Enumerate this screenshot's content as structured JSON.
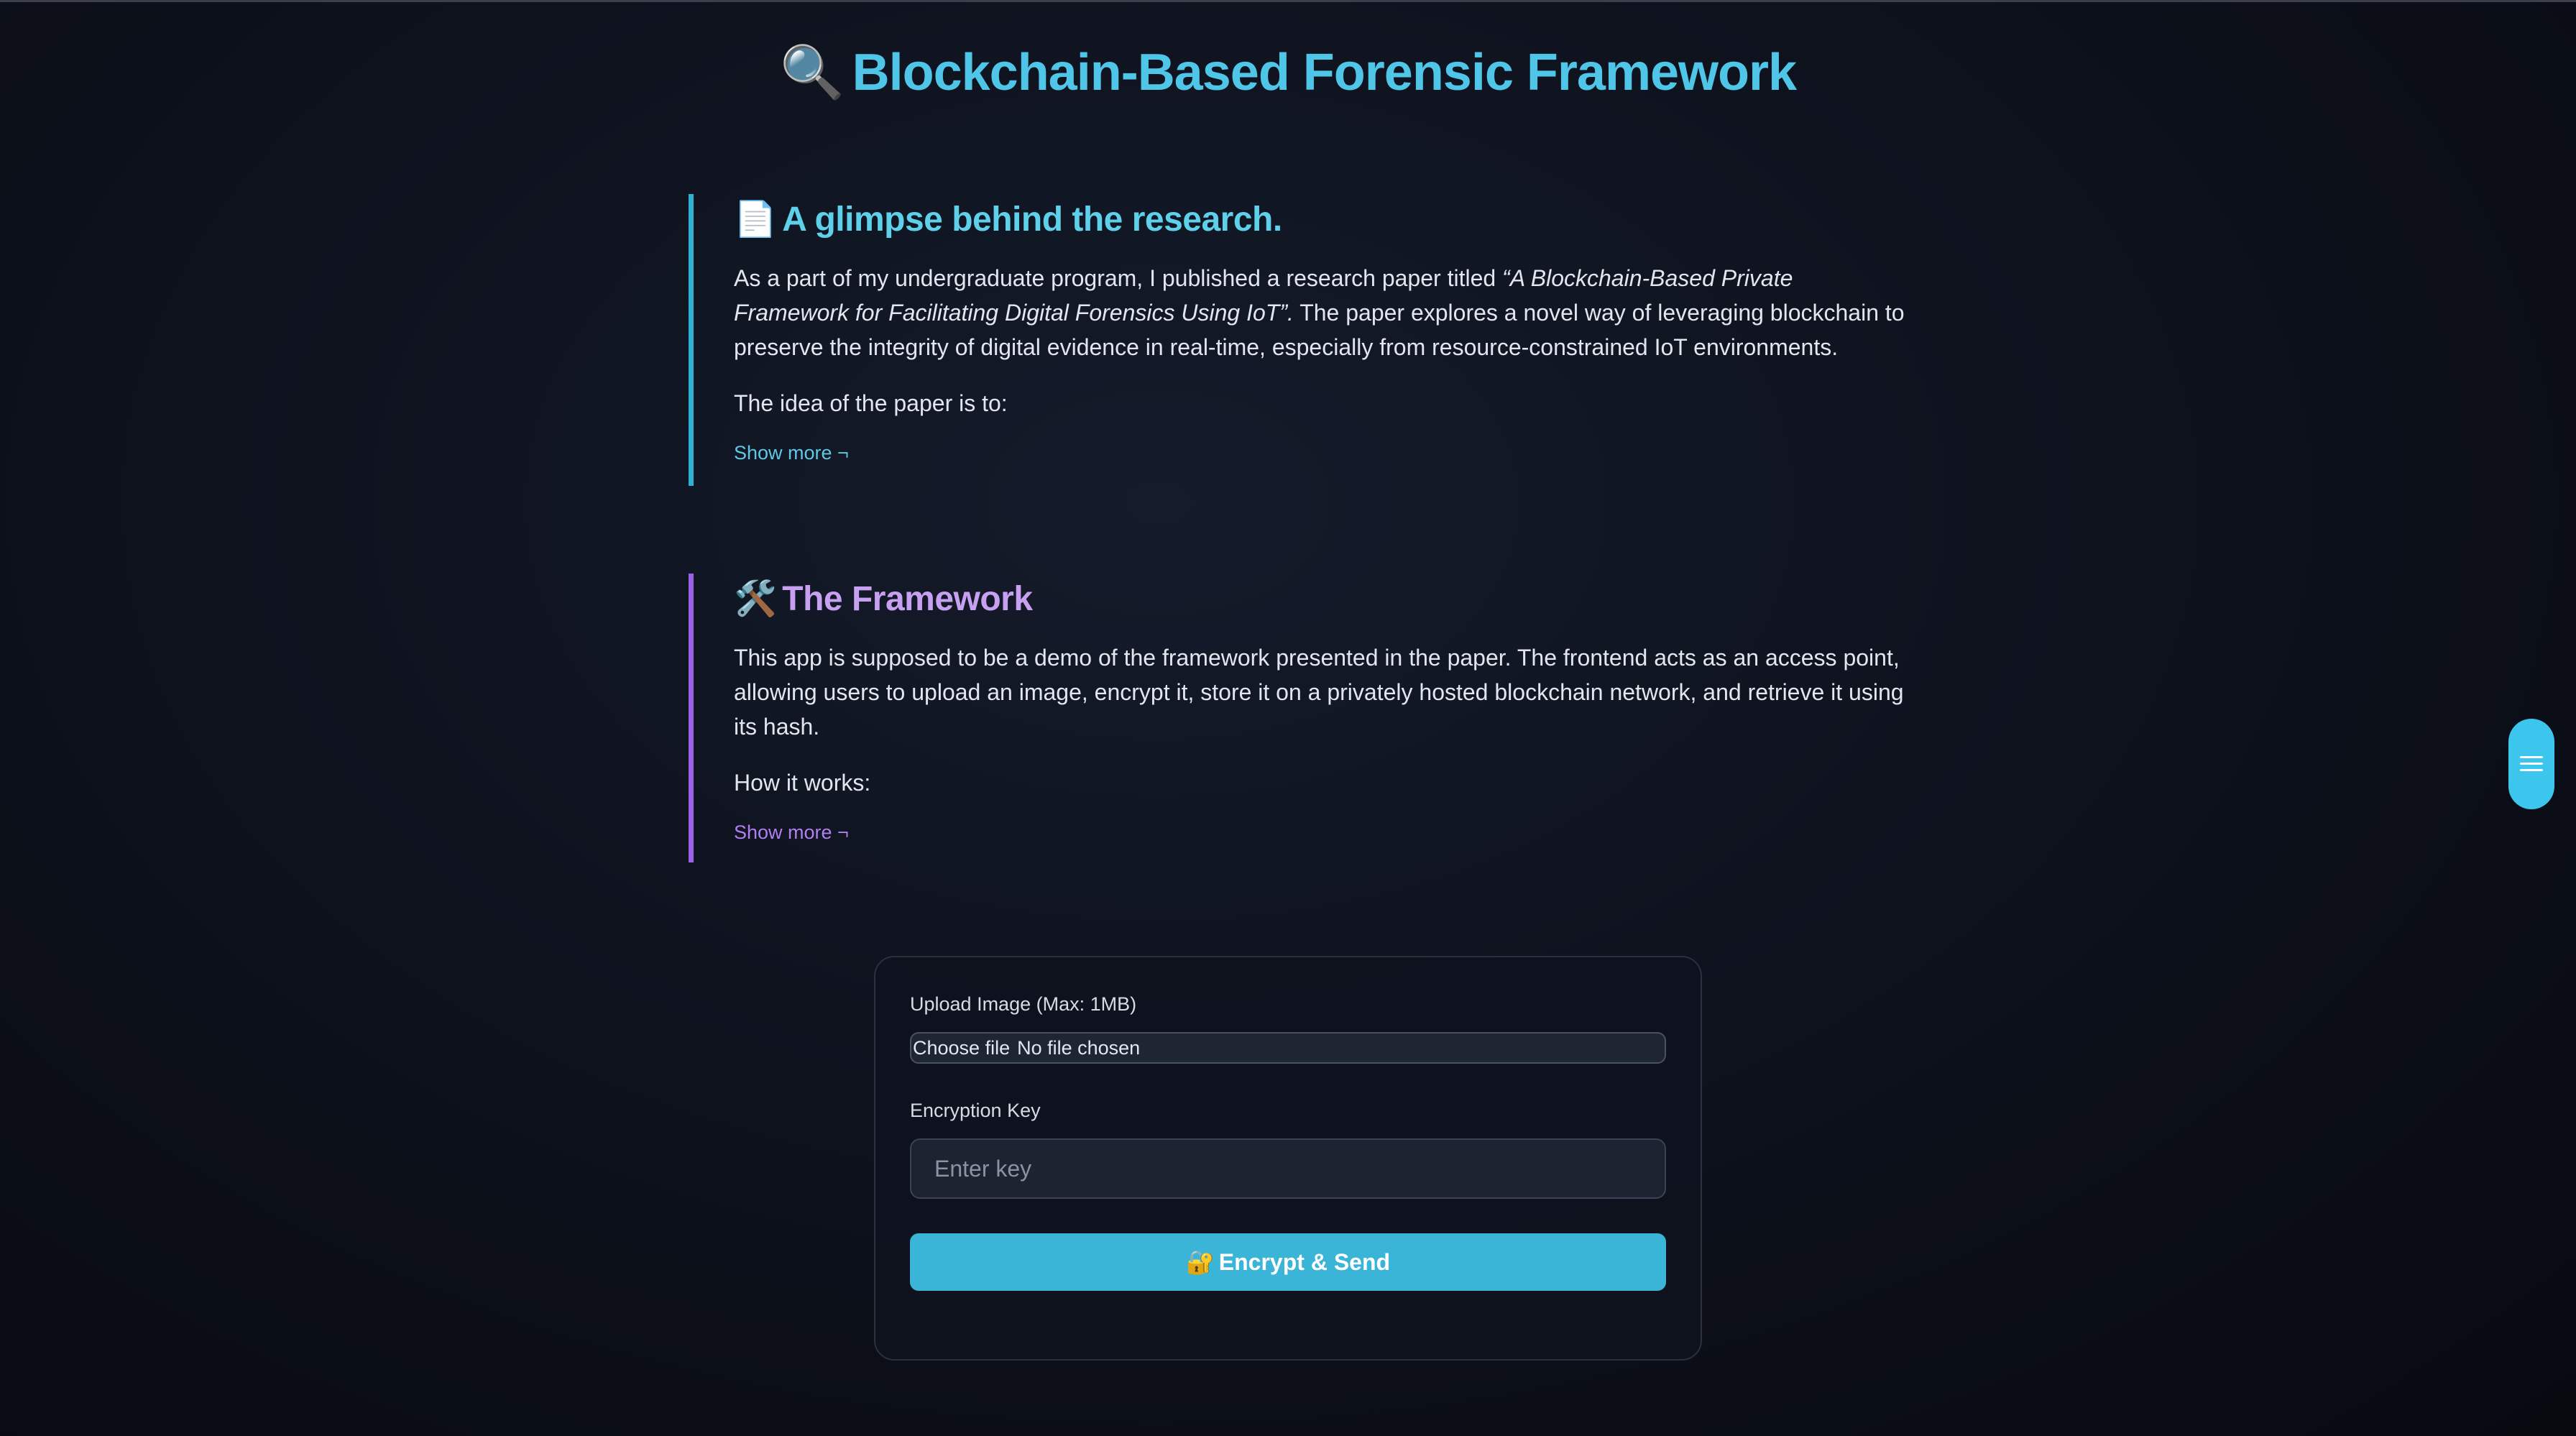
{
  "header": {
    "title_icon": "🔍",
    "title_icon_name": "magnifying-glass-icon",
    "title": "Blockchain-Based Forensic Framework"
  },
  "research": {
    "icon": "📄",
    "icon_name": "document-icon",
    "heading": "A glimpse behind the research.",
    "para_before": "As a part of my undergraduate program, I published a research paper titled ",
    "para_italic": "“A Blockchain-Based Private Framework for Facilitating Digital Forensics Using IoT”.",
    "para_after": " The paper explores a novel way of leveraging blockchain to preserve the integrity of digital evidence in real-time, especially from resource-constrained IoT environments.",
    "idea_line": "The idea of the paper is to:",
    "show_more": "Show more ¬",
    "accent_color": "#2fb0d4"
  },
  "framework": {
    "icon": "🛠️",
    "icon_name": "tools-icon",
    "heading": "The Framework",
    "para": "This app is supposed to be a demo of the framework presented in the paper. The frontend acts as an access point, allowing users to upload an image, encrypt it, store it on a privately hosted blockchain network, and retrieve it using its hash.",
    "how_line": "How it works:",
    "show_more": "Show more ¬",
    "accent_color": "#9a62e6"
  },
  "upload_form": {
    "upload_label": "Upload Image (Max: 1MB)",
    "choose_file": "Choose file",
    "no_file": "No file chosen",
    "key_label": "Encryption Key",
    "key_placeholder": "Enter key",
    "key_value": "",
    "submit_icon": "🔐",
    "submit_icon_name": "lock-key-icon",
    "submit_label": "Encrypt & Send",
    "button_color": "#3ab5d8"
  },
  "floating_menu": {
    "icon_name": "hamburger-menu-icon",
    "color": "#3cc6ee"
  }
}
